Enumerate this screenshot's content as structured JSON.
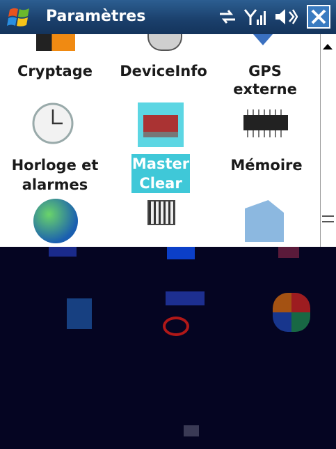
{
  "titlebar": {
    "title": "Paramètres"
  },
  "items": [
    {
      "label": "Cryptage"
    },
    {
      "label": "DeviceInfo"
    },
    {
      "label": "GPS externe"
    },
    {
      "label_line1": "Horloge et",
      "label_line2": "alarmes"
    },
    {
      "label_line1": "Master",
      "label_line2": "Clear"
    },
    {
      "label": "Mémoire"
    }
  ],
  "colors": {
    "selection": "#3fc8d8",
    "titlebar": "#1a3f6b"
  }
}
